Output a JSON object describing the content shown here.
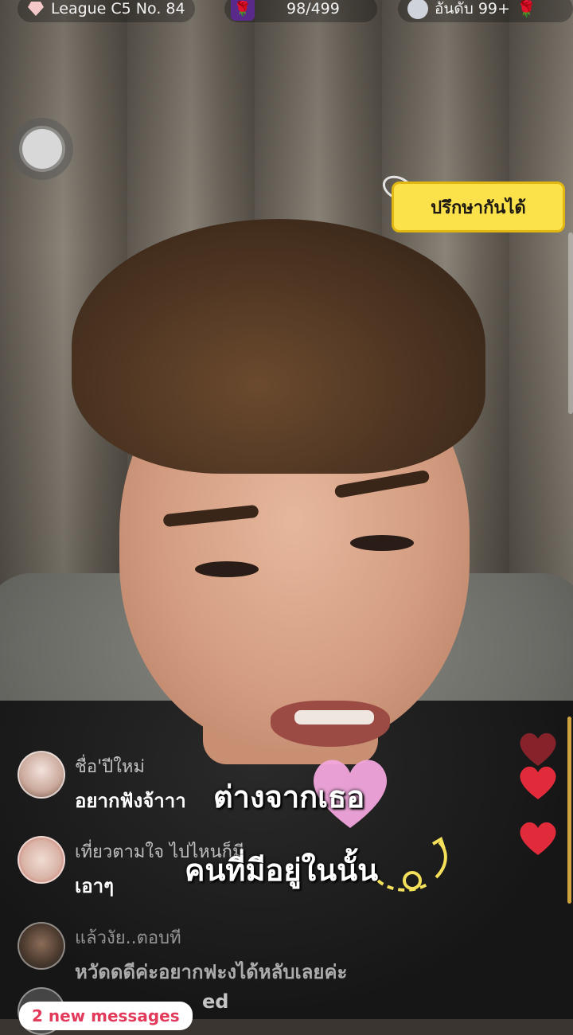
{
  "top_bar": {
    "league_label": "League C5 No. 84",
    "gift_progress": "98/499",
    "rank_label": "อันดับ 99+"
  },
  "floating_tag": {
    "label": "ปรึกษากันได้"
  },
  "comments": [
    {
      "user": "ชื่อ'ปีใหม่",
      "message": "อยากฟังจ้าาา"
    },
    {
      "user": "เที่ยวตามใจ ไปไหนก็มี",
      "message": "เอาๆ"
    },
    {
      "user": "แล้วงัย..ตอบที",
      "message": "หวัดดดีค่ะอยากฟะงได้หลับเลยค่ะ"
    },
    {
      "user": "",
      "message": "ed"
    }
  ],
  "new_messages": "2 new messages",
  "lyrics": {
    "line1": "ต่างจากเธอ",
    "line2": "คนที่มีอยู่ในนั้น"
  },
  "colors": {
    "tag_bg": "#fbe24a",
    "heart_red": "#e12b3a",
    "lyric_heart": "#f2a6dd"
  }
}
